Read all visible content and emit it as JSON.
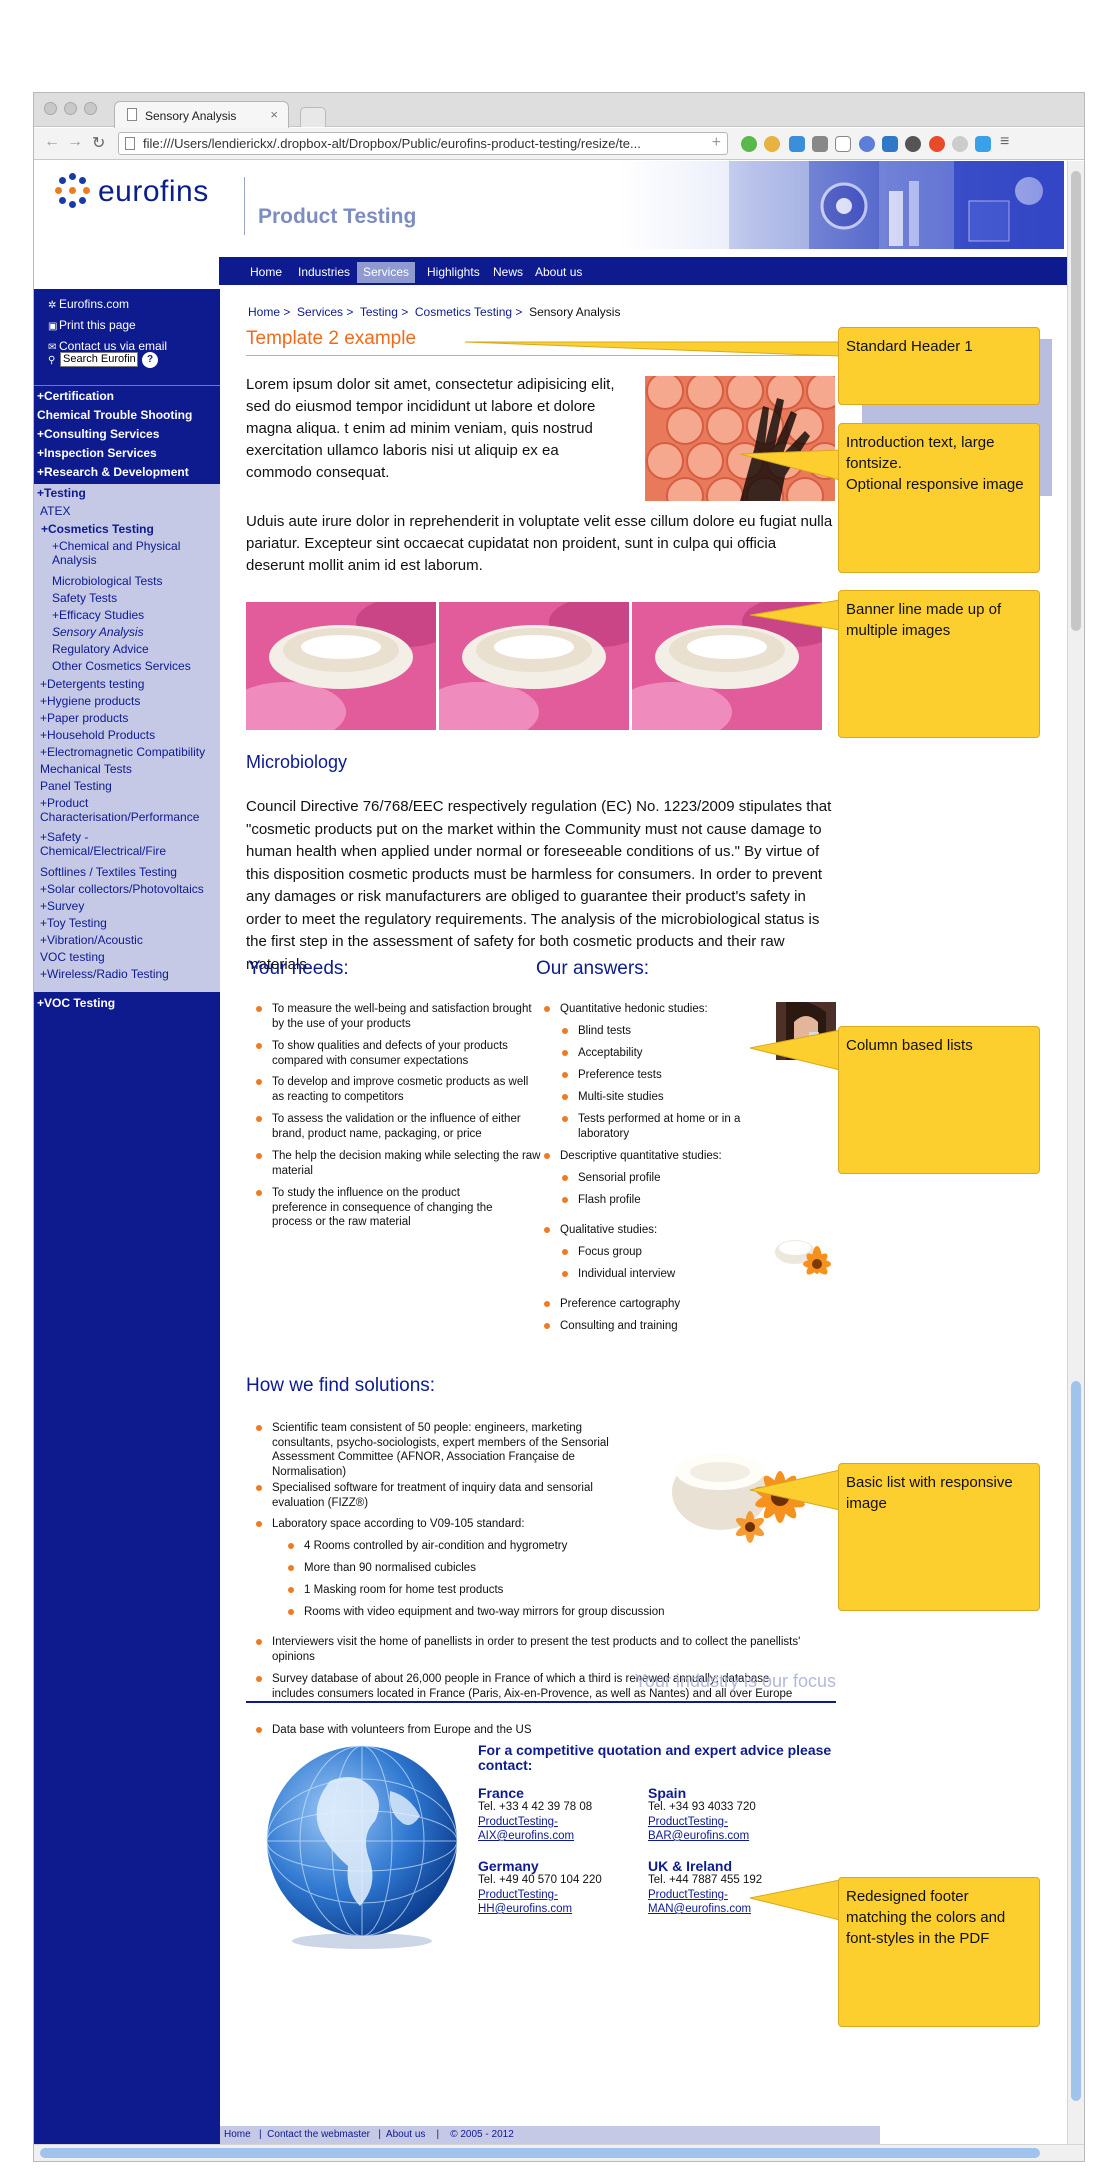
{
  "browser": {
    "tab_title": "Sensory Analysis",
    "url": "file:///Users/lendierickx/.dropbox-alt/Dropbox/Public/eurofins-product-testing/resize/te..."
  },
  "header": {
    "logo_text": "eurofins",
    "product_title": "Product Testing"
  },
  "topnav": [
    "Home",
    "Industries",
    "Services",
    "Highlights",
    "News",
    "About us"
  ],
  "sidebar": {
    "links": [
      "Eurofins.com",
      "Print this page",
      "Contact us via email"
    ],
    "search_value": "Search Eurofin",
    "search_help": "?",
    "categories_top": [
      "+Certification",
      "Chemical Trouble Shooting",
      "+Consulting Services",
      "+Inspection Services",
      "+Research & Development"
    ],
    "testing": "+Testing",
    "atex": "ATEX",
    "cosmetics": "+Cosmetics Testing",
    "cosmetics_sub": [
      "+Chemical and Physical Analysis",
      "Microbiological Tests",
      "Safety Tests",
      "+Efficacy Studies",
      "Sensory Analysis",
      "Regulatory Advice",
      "Other Cosmetics Services"
    ],
    "testing_sub": [
      "+Detergents testing",
      "+Hygiene products",
      "+Paper products",
      "+Household Products",
      "+Electromagnetic Compatibility",
      "Mechanical Tests",
      "Panel Testing",
      "+Product Characterisation/Performance",
      "+Safety - Chemical/Electrical/Fire",
      "Softlines / Textiles Testing",
      "+Solar collectors/Photovoltaics",
      "+Survey",
      "+Toy Testing",
      "+Vibration/Acoustic",
      "VOC testing",
      "+Wireless/Radio Testing"
    ],
    "voc": "+VOC Testing"
  },
  "breadcrumb": [
    "Home >",
    "Services >",
    "Testing >",
    "Cosmetics Testing >",
    "Sensory Analysis"
  ],
  "page_title": "Template 2 example",
  "intro": "Lorem ipsum dolor sit amet, consectetur adipisicing elit, sed do eiusmod tempor incididunt ut labore et dolore magna aliqua. t enim ad minim veniam, quis nostrud exercitation ullamco laboris nisi ut aliquip ex ea commodo consequat.",
  "para2": "Uduis aute irure dolor in reprehenderit in voluptate velit esse cillum dolore eu fugiat nulla pariatur. Excepteur sint occaecat cupidatat non proident, sunt in culpa qui officia deserunt mollit anim id est laborum.",
  "micro": {
    "title": "Microbiology",
    "text": "Council Directive 76/768/EEC respectively regulation (EC) No. 1223/2009 stipulates that \"cosmetic products put on the market within the Community must not cause damage to human health when applied under normal or foreseeable conditions of us.\" By virtue of this disposition cosmetic products must be harmless for consumers. In order to prevent any damages or risk manufacturers are obliged to guarantee their product's safety in order to meet the regulatory requirements. The analysis of the microbiological status is the first step in the assessment of safety for both cosmetic products and their raw materials."
  },
  "needs": {
    "title": "Your needs:",
    "items": [
      "To measure the well-being and satisfaction brought by the use of your products",
      "To show qualities and defects of your products compared with consumer expectations",
      "To develop and improve cosmetic products as well as reacting to competitors",
      "To assess the validation or the influence of either brand, product name, packaging, or price",
      "The help the decision making while selecting the raw material",
      "To study the influence on the product preference in consequence of changing the process or the raw material"
    ]
  },
  "answers": {
    "title": "Our answers:",
    "hedonic": "Quantitative hedonic studies:",
    "hedonic_items": [
      "Blind tests",
      "Acceptability",
      "Preference tests",
      "Multi-site studies",
      "Tests performed at home or in a laboratory"
    ],
    "descriptive": "Descriptive quantitative studies:",
    "descriptive_items": [
      "Sensorial profile",
      "Flash profile"
    ],
    "qualitative": "Qualitative studies:",
    "qualitative_items": [
      "Focus group",
      "Individual interview"
    ],
    "extra": [
      "Preference cartography",
      "Consulting and training"
    ]
  },
  "solutions": {
    "title": "How we find solutions:",
    "item1": "Scientific team consistent of 50 people: engineers, marketing consultants, psycho-sociologists, expert members of the Sensorial Assessment Committee (AFNOR, Association Française de Normalisation)",
    "item2": "Specialised software for treatment of inquiry data and sensorial evaluation (FIZZ®)",
    "item3": "Laboratory space according to V09-105 standard:",
    "lab_items": [
      "4 Rooms controlled by air-condition and hygrometry",
      "More than 90 normalised cubicles",
      "1 Masking room for home test products",
      "Rooms with video equipment and two-way mirrors for group discussion"
    ],
    "item4": "Interviewers visit the home of panellists in order to present the test products and to collect the panellists' opinions",
    "item5": "Survey database of about 26,000 people in France of which a third is renewed annually; database includes consumers located in France (Paris, Aix-en-Provence, as well as Nantes) and all over Europe",
    "item6": "Data base with volunteers from Europe and the US"
  },
  "footer": {
    "tagline": "Your industry is our focus",
    "quote": "For a competitive quotation and expert advice please contact:",
    "contacts": [
      {
        "country": "France",
        "tel": "Tel. +33 4 42 39 78 08",
        "mail": "ProductTesting-AIX@eurofins.com"
      },
      {
        "country": "Spain",
        "tel": "Tel. +34 93 4033 720",
        "mail": "ProductTesting-BAR@eurofins.com"
      },
      {
        "country": "Germany",
        "tel": "Tel. +49 40 570 104 220",
        "mail": "ProductTesting-HH@eurofins.com"
      },
      {
        "country": "UK & Ireland",
        "tel": "Tel. +44 7887 455 192",
        "mail": "ProductTesting-MAN@eurofins.com"
      }
    ],
    "bottom": "Home   |  Contact the webmaster   |  About us    |    © 2005 - 2012"
  },
  "notes": [
    "Standard Header 1",
    "Introduction text, large fontsize.\nOptional responsive image",
    "Banner line made up of multiple images",
    "Column based lists",
    "Basic list with responsive image",
    "Redesigned footer matching the colors and font-styles in the PDF"
  ],
  "colors": {
    "navy": "#0d1b8f",
    "orange": "#f26a1b",
    "lavender": "#c6c9e6",
    "note": "#fccf2e"
  }
}
